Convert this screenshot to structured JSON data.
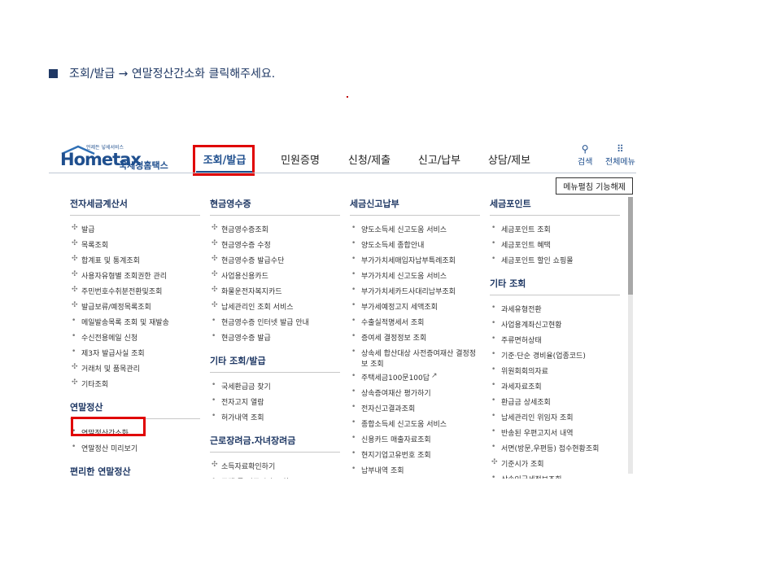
{
  "instruction": {
    "bullet_icon": "square-icon",
    "text": "조회/발급 → 연말정산간소화 클릭해주세요."
  },
  "header": {
    "logo": {
      "main": "Hometax",
      "sub": "국세청홈택스",
      "tag": "언제든 넣세서비스"
    },
    "nav": [
      "조회/발급",
      "민원증명",
      "신청/제출",
      "신고/납부",
      "상담/제보"
    ],
    "active_nav": "조회/발급",
    "search": {
      "icon": "search-icon",
      "label": "검색"
    },
    "all_menu": {
      "icon": "grid-icon",
      "label": "전체메뉴"
    },
    "menu_button": "메뉴펼침 기능해제"
  },
  "columns": [
    {
      "sections": [
        {
          "title": "전자세금계산서",
          "items": [
            {
              "b": "✣",
              "t": "발급"
            },
            {
              "b": "✣",
              "t": "목록조회"
            },
            {
              "b": "✣",
              "t": "합계표 및 통계조회"
            },
            {
              "b": "✣",
              "t": "사용자유형별 조회권한 관리"
            },
            {
              "b": "✣",
              "t": "주민번호수취분전환및조회"
            },
            {
              "b": "✣",
              "t": "발급보류/예정목록조회"
            },
            {
              "b": "•",
              "t": "메일발송목록 조회 및 재발송"
            },
            {
              "b": "•",
              "t": "수신전용메일 신청"
            },
            {
              "b": "•",
              "t": "제3자 발급사실 조회"
            },
            {
              "b": "✣",
              "t": "거래처 및 품목관리"
            },
            {
              "b": "✣",
              "t": "기타조회"
            }
          ]
        },
        {
          "title": "연말정산",
          "items": [
            {
              "b": "•",
              "t": "연말정산간소화"
            },
            {
              "b": "•",
              "t": "연말정산 미리보기"
            }
          ]
        },
        {
          "title": "편리한 연말정산",
          "items": []
        }
      ]
    },
    {
      "sections": [
        {
          "title": "현금영수증",
          "items": [
            {
              "b": "✣",
              "t": "현금영수증조회"
            },
            {
              "b": "✣",
              "t": "현금영수증 수정"
            },
            {
              "b": "✣",
              "t": "현금영수증 발급수단"
            },
            {
              "b": "✣",
              "t": "사업용신용카드"
            },
            {
              "b": "✣",
              "t": "화물운전자복지카드"
            },
            {
              "b": "✣",
              "t": "납세관리인 조회 서비스"
            },
            {
              "b": "•",
              "t": "현금영수증 인터넷 발급 안내"
            },
            {
              "b": "•",
              "t": "현금영수증 발급"
            }
          ]
        },
        {
          "title": "기타 조회/발급",
          "items": [
            {
              "b": "•",
              "t": "국세환급금 찾기"
            },
            {
              "b": "•",
              "t": "전자고지 열람"
            },
            {
              "b": "•",
              "t": "허가내역 조회"
            }
          ]
        },
        {
          "title": "근로장려금.자녀장려금",
          "items": [
            {
              "b": "✣",
              "t": "소득자료확인하기"
            },
            {
              "b": "•",
              "t": "주택 등 기준시가 조회"
            }
          ]
        }
      ]
    },
    {
      "sections": [
        {
          "title": "세금신고납부",
          "items": [
            {
              "b": "•",
              "t": "양도소득세 신고도움 서비스"
            },
            {
              "b": "•",
              "t": "양도소득세 종합안내"
            },
            {
              "b": "•",
              "t": "부가가치세매입자납부특례조회"
            },
            {
              "b": "•",
              "t": "부가가치세 신고도움 서비스"
            },
            {
              "b": "•",
              "t": "부가가치세카드사대리납부조회"
            },
            {
              "b": "•",
              "t": "부가세예정고지 세액조회"
            },
            {
              "b": "•",
              "t": "수출실적명세서 조회"
            },
            {
              "b": "•",
              "t": "증여세 결정정보 조회"
            },
            {
              "b": "•",
              "t": "상속세 합산대상 사전증여재산 결정정보 조회",
              "tall": true
            },
            {
              "b": "•",
              "t": "주택세금100문100답",
              "ext": "↗"
            },
            {
              "b": "•",
              "t": "상속증여재산 평가하기"
            },
            {
              "b": "•",
              "t": "전자신고결과조회"
            },
            {
              "b": "•",
              "t": "종합소득세 신고도움 서비스"
            },
            {
              "b": "•",
              "t": "신용카드 매출자료조회"
            },
            {
              "b": "•",
              "t": "현지기업고유번호 조회"
            },
            {
              "b": "•",
              "t": "납부내역 조회"
            }
          ]
        }
      ]
    },
    {
      "sections": [
        {
          "title": "세금포인트",
          "items": [
            {
              "b": "•",
              "t": "세금포인트 조회"
            },
            {
              "b": "•",
              "t": "세금포인트 혜택"
            },
            {
              "b": "•",
              "t": "세금포인트 할인 쇼핑몰"
            }
          ]
        },
        {
          "title": "기타 조회",
          "items": [
            {
              "b": "•",
              "t": "과세유형전환"
            },
            {
              "b": "•",
              "t": "사업용계좌신고현황"
            },
            {
              "b": "•",
              "t": "주류면허상태"
            },
            {
              "b": "•",
              "t": "기준·단순 경비율(업종코드)"
            },
            {
              "b": "•",
              "t": "위원회회의자료"
            },
            {
              "b": "•",
              "t": "과세자료조회"
            },
            {
              "b": "•",
              "t": "환급금 상세조회"
            },
            {
              "b": "•",
              "t": "납세관리인 위임자 조회"
            },
            {
              "b": "•",
              "t": "반송된 우편고지서 내역"
            },
            {
              "b": "•",
              "t": "서면(방문,우편등) 접수현황조회"
            },
            {
              "b": "✣",
              "t": "기준시가 조회"
            },
            {
              "b": "•",
              "t": "상속인국세정보조회"
            }
          ]
        }
      ]
    }
  ]
}
